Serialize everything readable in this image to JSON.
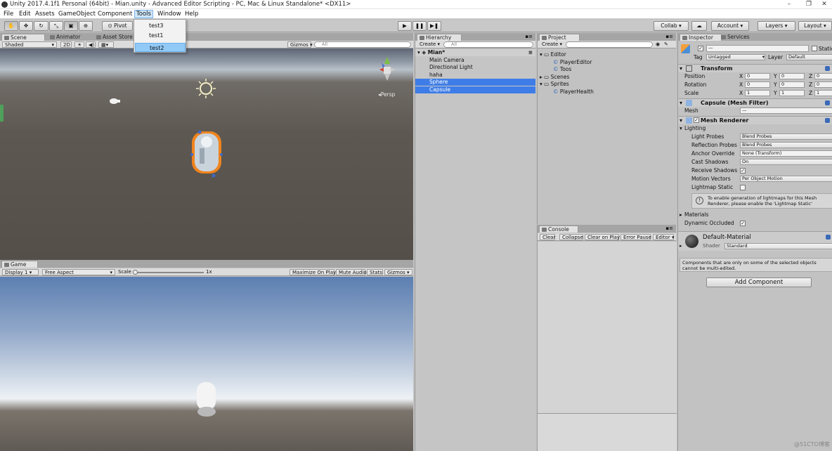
{
  "window": {
    "title": "Unity 2017.4.1f1 Personal (64bit) - Mian.unity - Advanced Editor Scripting - PC, Mac & Linux Standalone* <DX11>"
  },
  "menu": {
    "items": [
      "File",
      "Edit",
      "Assets",
      "GameObject",
      "Component",
      "Tools",
      "Window",
      "Help"
    ],
    "active": "Tools"
  },
  "tools_menu": {
    "items": [
      "test3",
      "test1",
      "test2"
    ],
    "highlighted": "test2"
  },
  "toolbar": {
    "pivot": "Pivot",
    "collab": "Collab ▾",
    "account": "Account",
    "layers": "Layers",
    "layout": "Layout"
  },
  "scene": {
    "tabs": [
      "Scene",
      "Animator",
      "Asset Store"
    ],
    "shading": "Shaded",
    "mode_2d": "2D",
    "gizmos": "Gizmos",
    "search": "All",
    "persp": "Persp"
  },
  "game": {
    "tab": "Game",
    "display": "Display 1",
    "aspect": "Free Aspect",
    "scale_label": "Scale",
    "scale_value": "1x",
    "buttons": [
      "Maximize On Play",
      "Mute Audio",
      "Stats",
      "Gizmos"
    ]
  },
  "hierarchy": {
    "tab": "Hierarchy",
    "create": "Create",
    "search": "All",
    "scene": "Mian*",
    "items": [
      {
        "label": "Main Camera",
        "selected": false
      },
      {
        "label": "Directional Light",
        "selected": false
      },
      {
        "label": "haha",
        "selected": false
      },
      {
        "label": "Sphere",
        "selected": true
      },
      {
        "label": "Capsule",
        "selected": true
      }
    ]
  },
  "project": {
    "tab": "Project",
    "create": "Create",
    "tree": [
      {
        "label": "Editor",
        "depth": 0,
        "kind": "folder"
      },
      {
        "label": "PlayerEditor",
        "depth": 1,
        "kind": "script"
      },
      {
        "label": "Toos",
        "depth": 1,
        "kind": "script"
      },
      {
        "label": "Scenes",
        "depth": 0,
        "kind": "folder"
      },
      {
        "label": "Sprites",
        "depth": 0,
        "kind": "folder"
      },
      {
        "label": "PlayerHealth",
        "depth": 1,
        "kind": "script"
      }
    ]
  },
  "console": {
    "tab": "Console",
    "buttons": [
      "Clear",
      "Collapse",
      "Clear on Play",
      "Error Pause",
      "Editor ▾"
    ]
  },
  "inspector": {
    "tabs": [
      "Inspector",
      "Services"
    ],
    "name_value": "—",
    "static_label": "Static",
    "tag_label": "Tag",
    "tag_value": "Untagged",
    "layer_label": "Layer",
    "layer_value": "Default",
    "transform": {
      "title": "Transform",
      "rows": [
        {
          "label": "Position",
          "x": "0",
          "y": "0",
          "z": "0"
        },
        {
          "label": "Rotation",
          "x": "0",
          "y": "0",
          "z": "0"
        },
        {
          "label": "Scale",
          "x": "1",
          "y": "1",
          "z": "1"
        }
      ],
      "axis_x": "X",
      "axis_y": "Y",
      "axis_z": "Z"
    },
    "mesh_filter": {
      "title": "Capsule (Mesh Filter)",
      "mesh_label": "Mesh",
      "mesh_value": "—"
    },
    "mesh_renderer": {
      "title": "Mesh Renderer",
      "lighting_label": "Lighting",
      "rows": [
        {
          "label": "Light Probes",
          "value": "Blend Probes"
        },
        {
          "label": "Reflection Probes",
          "value": "Blend Probes"
        },
        {
          "label": "Anchor Override",
          "value": "None (Transform)"
        },
        {
          "label": "Cast Shadows",
          "value": "On"
        },
        {
          "label": "Receive Shadows",
          "value": "✓"
        },
        {
          "label": "Motion Vectors",
          "value": "Per Object Motion"
        },
        {
          "label": "Lightmap Static",
          "value": ""
        }
      ],
      "info": "To enable generation of lightmaps for this Mesh Renderer, please enable the 'Lightmap Static' property.",
      "materials_label": "Materials",
      "occluded_label": "Dynamic Occluded"
    },
    "material": {
      "name": "Default-Material",
      "shader_label": "Shader",
      "shader_value": "Standard"
    },
    "multi_edit_note": "Components that are only on some of the selected objects cannot be multi-edited.",
    "add_component": "Add Component"
  },
  "watermark": "@51CTO博客"
}
